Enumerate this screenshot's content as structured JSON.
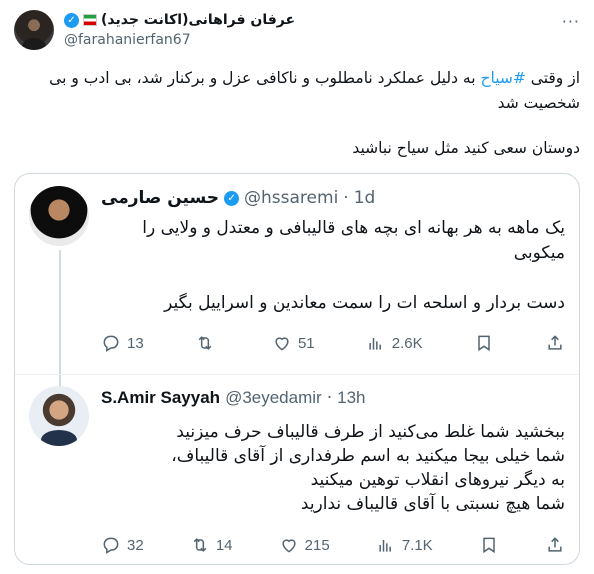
{
  "post": {
    "author_name": "عرفان فراهانی(اکانت جدید)",
    "handle": "@farahanierfan67",
    "more": "···",
    "text_prefix": "از وقتی ",
    "hashtag": "#سیاح",
    "text_suffix": " به دلیل عملکرد نامطلوب و ناکافی عزل و برکنار شد، بی ادب و بی شخصیت شد",
    "text_para2": "دوستان سعی کنید مثل سیاح نباشید"
  },
  "quoted": {
    "replies": [
      {
        "name": "حسین صارمی",
        "handle": "@hssaremi",
        "sep": "·",
        "time": "1d",
        "text_1": "یک ماهه به هر بهانه ای بچه های قالیبافی و معتدل و ولایی را میکوبی",
        "text_2": "دست بردار و اسلحه ات را سمت معاندین و اسراییل بگیر",
        "replies": "13",
        "reposts": "",
        "likes": "51",
        "views": "2.6K"
      },
      {
        "name": "S.Amir Sayyah",
        "handle": "@3eyedamir",
        "sep": "·",
        "time": "13h",
        "text_1": "ببخشید شما غلط می‌کنید از طرف قالیباف حرف میزنید",
        "text_2": "شما خیلی بیجا میکنید به اسم طرفداری از آقای قالیباف،",
        "text_3": "به دیگر نیروهای انقلاب توهین میکنید",
        "text_4": "شما هیچ نسبتی با آقای قالیباف ندارید",
        "replies": "32",
        "reposts": "14",
        "likes": "215",
        "views": "7.1K"
      }
    ]
  },
  "colors": {
    "accent": "#1d9bf0",
    "muted": "#536471",
    "border": "#cfd9de"
  },
  "icons": [
    "verified-icon",
    "iran-flag-icon",
    "more-icon",
    "reply-icon",
    "repost-icon",
    "like-icon",
    "views-icon",
    "bookmark-icon",
    "share-icon"
  ]
}
